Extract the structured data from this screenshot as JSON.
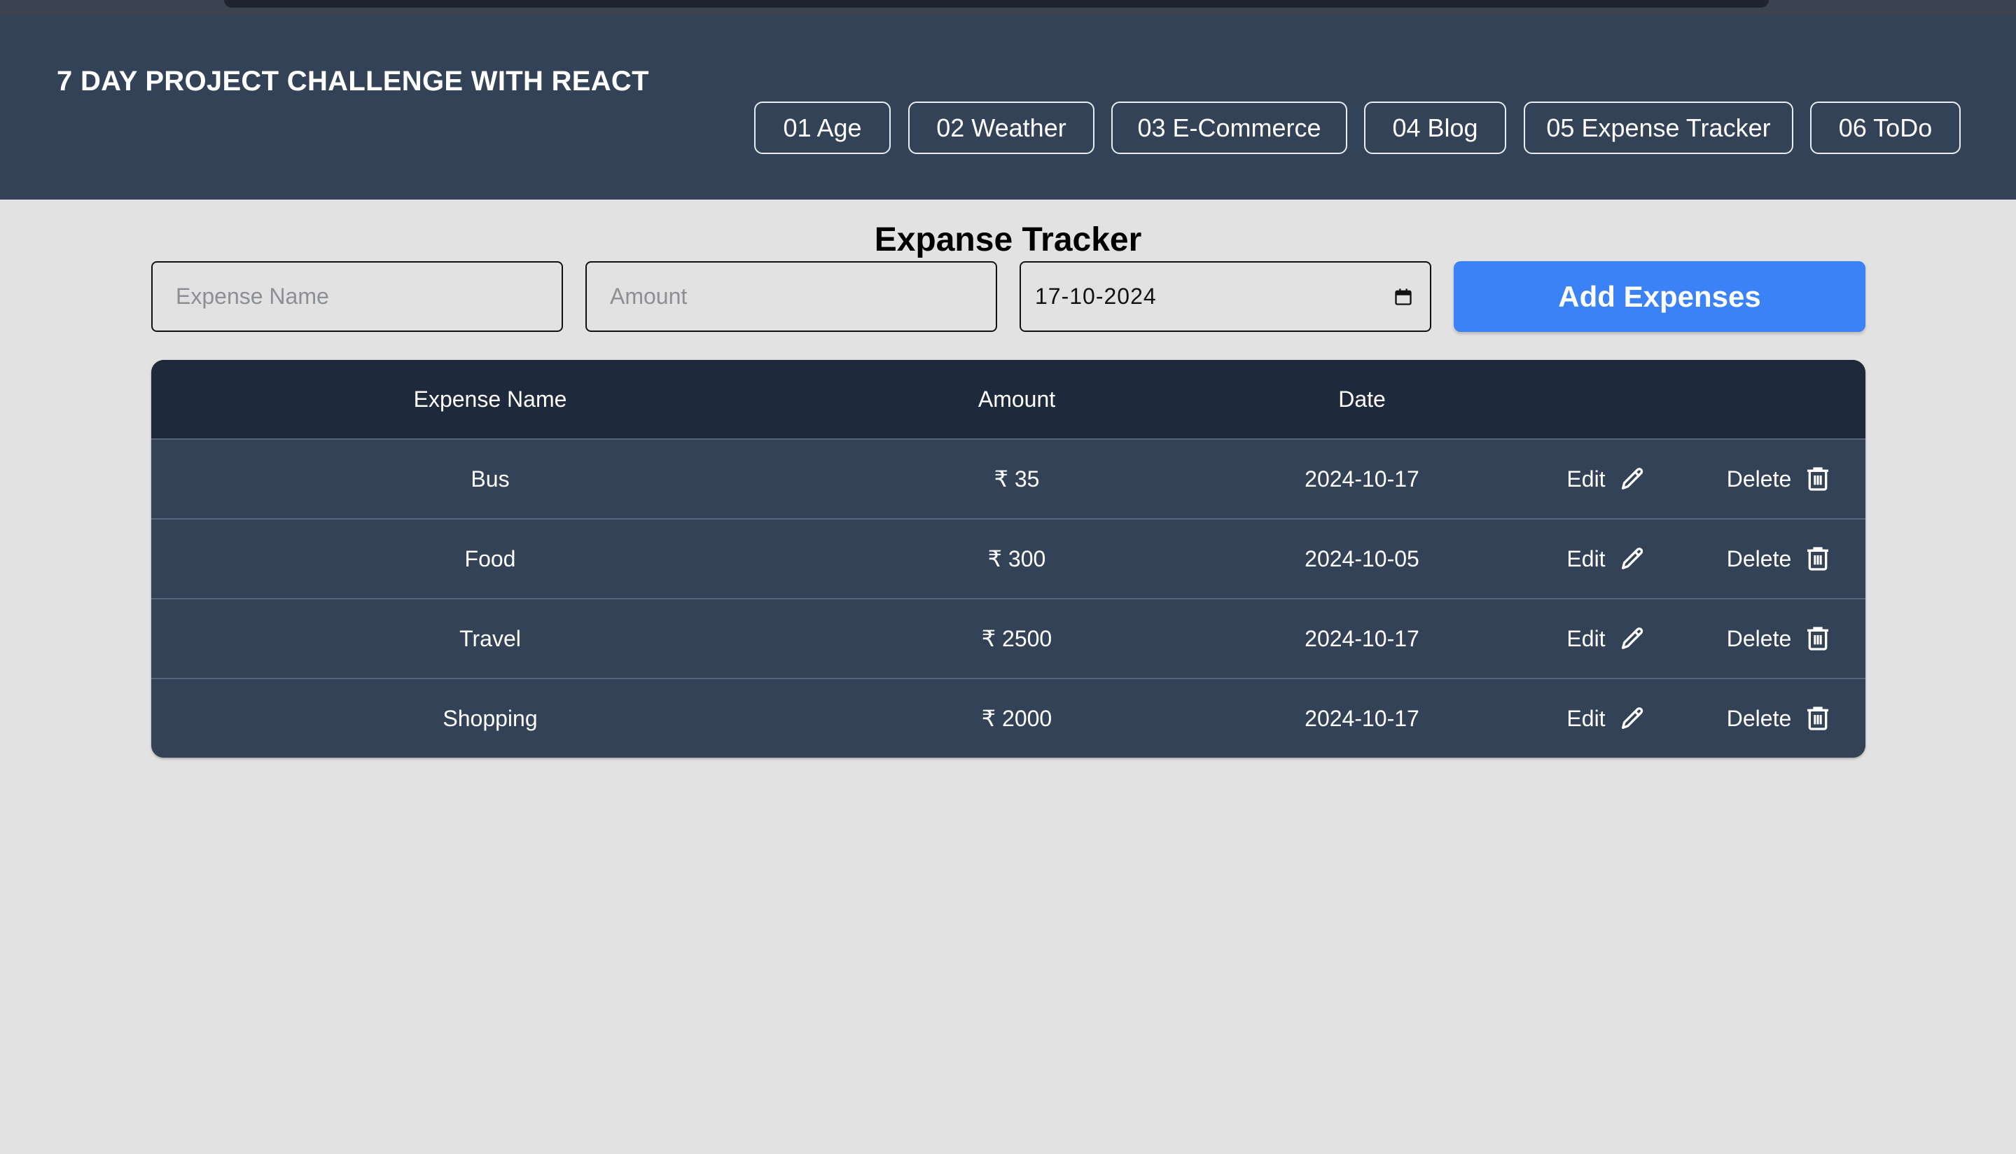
{
  "header": {
    "brand": "7 DAY PROJECT CHALLENGE WITH REACT",
    "nav": [
      {
        "label": "01 Age"
      },
      {
        "label": "02 Weather"
      },
      {
        "label": "03 E-Commerce"
      },
      {
        "label": "04 Blog"
      },
      {
        "label": "05 Expense Tracker"
      },
      {
        "label": "06 ToDo"
      }
    ]
  },
  "main": {
    "title": "Expanse Tracker",
    "form": {
      "name_placeholder": "Expense Name",
      "amount_placeholder": "Amount",
      "date_value": "17-10-2024",
      "add_label": "Add Expenses"
    },
    "table": {
      "columns": [
        "Expense Name",
        "Amount",
        "Date"
      ],
      "edit_label": "Edit",
      "delete_label": "Delete",
      "rows": [
        {
          "name": "Bus",
          "amount": "₹ 35",
          "date": "2024-10-17"
        },
        {
          "name": "Food",
          "amount": "₹ 300",
          "date": "2024-10-05"
        },
        {
          "name": "Travel",
          "amount": "₹ 2500",
          "date": "2024-10-17"
        },
        {
          "name": "Shopping",
          "amount": "₹ 2000",
          "date": "2024-10-17"
        }
      ]
    }
  },
  "colors": {
    "header_bg": "#334257",
    "table_head_bg": "#1e293b",
    "accent": "#3b82f6",
    "page_bg": "#e2e2e2"
  }
}
